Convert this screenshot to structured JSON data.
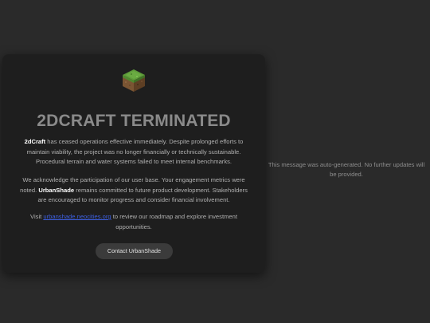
{
  "card": {
    "logo_icon": "grass-block-icon",
    "title": "2DCRAFT TERMINATED",
    "paragraph1": {
      "brand": "2dCraft",
      "text": " has ceased operations effective immediately. Despite prolonged efforts to maintain viability, the project was no longer financially or technically sustainable. Procedural terrain and water systems failed to meet internal benchmarks."
    },
    "paragraph2": {
      "text_before": "We acknowledge the participation of our user base. Your engagement metrics were noted. ",
      "company": "UrbanShade",
      "text_after": " remains committed to future product development. Stakeholders are encouraged to monitor progress and consider financial involvement."
    },
    "paragraph3": {
      "text_before": "Visit ",
      "link_text": "urbanshade.neocities.org",
      "text_after": " to review our roadmap and explore investment opportunities."
    },
    "button_label": "Contact UrbanShade"
  },
  "side_note": "This message was auto-generated. No further updates will be provided.",
  "colors": {
    "page_background": "#2a2a2a",
    "card_background": "#1e1e1e",
    "link": "#3d5fe0",
    "button_background": "#3b3b3b"
  }
}
